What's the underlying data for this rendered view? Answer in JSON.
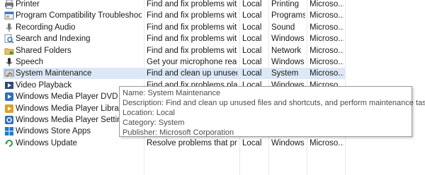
{
  "rows": [
    {
      "name": "Printer",
      "desc": "Find and fix problems with...",
      "loc": "Local",
      "cat": "Printing",
      "pub": "Microso...",
      "icon": "printer-icon"
    },
    {
      "name": "Program Compatibility Troubleshooter",
      "desc": "Find and fix problems with...",
      "loc": "Local",
      "cat": "Programs",
      "pub": "Microso...",
      "icon": "program-compatibility-icon"
    },
    {
      "name": "Recording Audio",
      "desc": "Find and fix problems with...",
      "loc": "Local",
      "cat": "Sound",
      "pub": "Microso...",
      "icon": "microphone-icon"
    },
    {
      "name": "Search and Indexing",
      "desc": "Find and fix problems with...",
      "loc": "Local",
      "cat": "Windows",
      "pub": "Microso...",
      "icon": "search-indexing-icon"
    },
    {
      "name": "Shared Folders",
      "desc": "Find and fix problems with...",
      "loc": "Local",
      "cat": "Network",
      "pub": "Microso...",
      "icon": "shared-folders-icon"
    },
    {
      "name": "Speech",
      "desc": "Get your microphone read...",
      "loc": "Local",
      "cat": "Windows",
      "pub": "Microso...",
      "icon": "speech-microphone-icon"
    },
    {
      "name": "System Maintenance",
      "desc": "Find and clean up unused f...",
      "loc": "Local",
      "cat": "System",
      "pub": "Microso...",
      "icon": "system-maintenance-icon"
    },
    {
      "name": "Video Playback",
      "desc": "Find and fix problems play...",
      "loc": "Local",
      "cat": "Windows",
      "pub": "Microso...",
      "icon": "video-playback-icon"
    },
    {
      "name": "Windows Media Player DVD",
      "desc": "",
      "loc": "",
      "cat": "",
      "pub": "",
      "icon": "media-player-dvd-icon"
    },
    {
      "name": "Windows Media Player Library",
      "desc": "",
      "loc": "",
      "cat": "",
      "pub": "",
      "icon": "media-player-library-icon"
    },
    {
      "name": "Windows Media Player Settings",
      "desc": "",
      "loc": "",
      "cat": "",
      "pub": "",
      "icon": "media-player-settings-icon"
    },
    {
      "name": "Windows Store Apps",
      "desc": "",
      "loc": "",
      "cat": "",
      "pub": "",
      "icon": "store-apps-icon"
    },
    {
      "name": "Windows Update",
      "desc": "Resolve problems that pre...",
      "loc": "Local",
      "cat": "Windows",
      "pub": "Microso...",
      "icon": "windows-update-icon"
    }
  ],
  "selected_row": "System Maintenance",
  "tooltip": {
    "name": "Name: System Maintenance",
    "description": "Description: Find and clean up unused files and shortcuts, and perform maintenance tasks.",
    "location": "Location: Local",
    "category": "Category: System",
    "publisher": "Publisher: Microsoft Corporation"
  },
  "colors": {
    "selection": "#dce8f6",
    "tooltip_border": "#9a9a9a",
    "tooltip_text": "#4d4d4d"
  }
}
